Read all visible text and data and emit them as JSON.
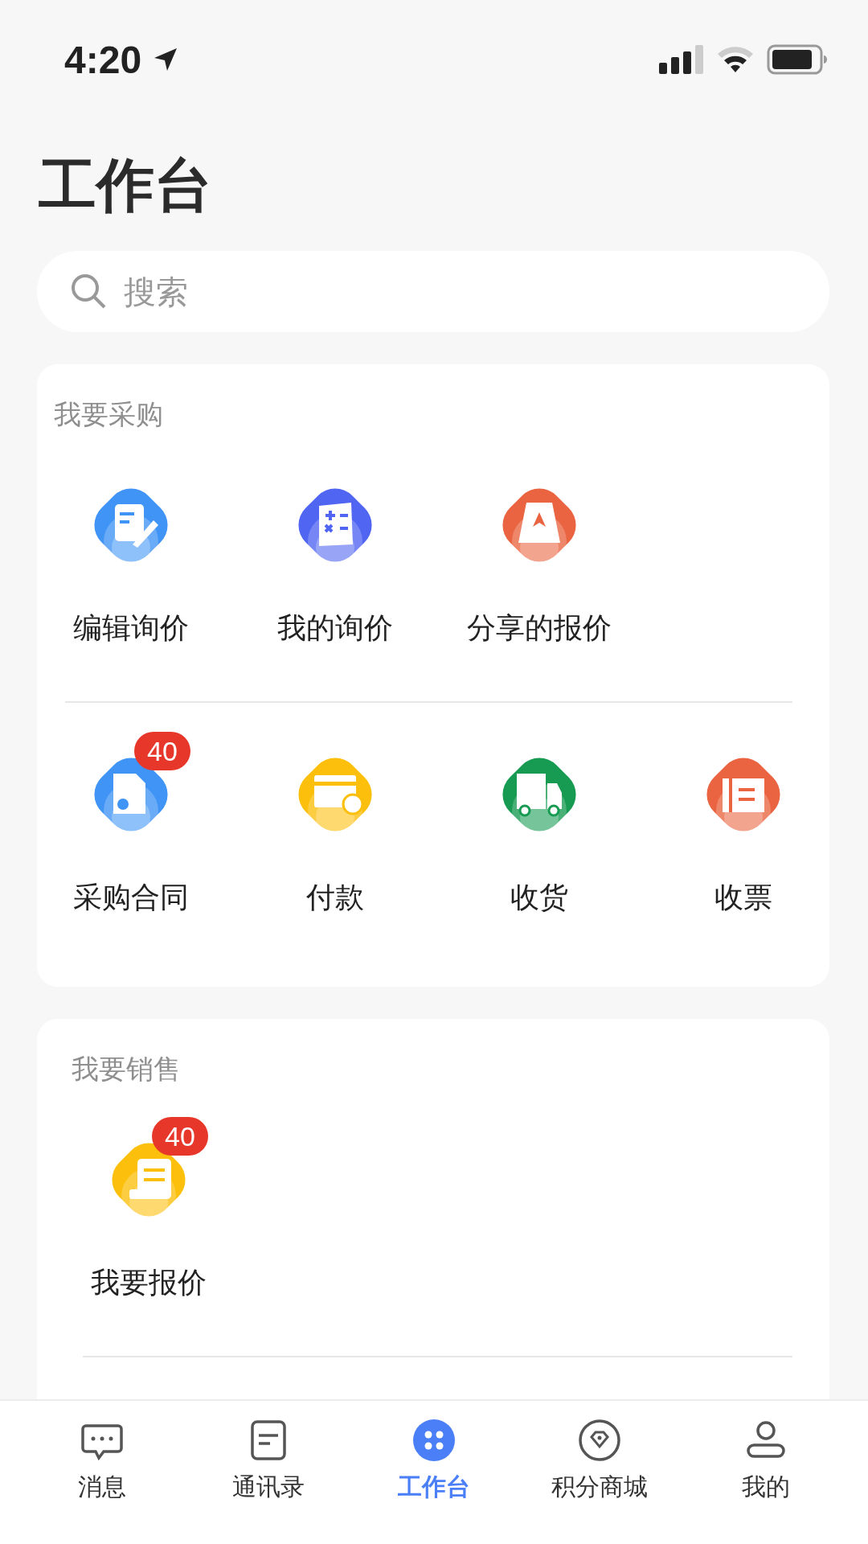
{
  "status_bar": {
    "time": "4:20"
  },
  "title": "工作台",
  "search": {
    "placeholder": "搜索"
  },
  "sections": [
    {
      "title": "我要采购",
      "groups": [
        [
          {
            "label": "编辑询价",
            "color": "#3f94f5"
          },
          {
            "label": "我的询价",
            "color": "#5066f2"
          },
          {
            "label": "分享的报价",
            "color": "#ea6441"
          }
        ],
        [
          {
            "label": "采购合同",
            "color": "#3f94f5",
            "badge": "40"
          },
          {
            "label": "付款",
            "color": "#fbbf0c"
          },
          {
            "label": "收货",
            "color": "#179a51"
          },
          {
            "label": "收票",
            "color": "#ea6441"
          }
        ]
      ]
    },
    {
      "title": "我要销售",
      "groups": [
        [
          {
            "label": "我要报价",
            "color": "#fbbf0c",
            "badge": "40"
          }
        ]
      ]
    }
  ],
  "tab_bar": [
    {
      "label": "消息",
      "selected": false
    },
    {
      "label": "通讯录",
      "selected": false
    },
    {
      "label": "工作台",
      "selected": true
    },
    {
      "label": "积分商城",
      "selected": false
    },
    {
      "label": "我的",
      "selected": false
    }
  ]
}
